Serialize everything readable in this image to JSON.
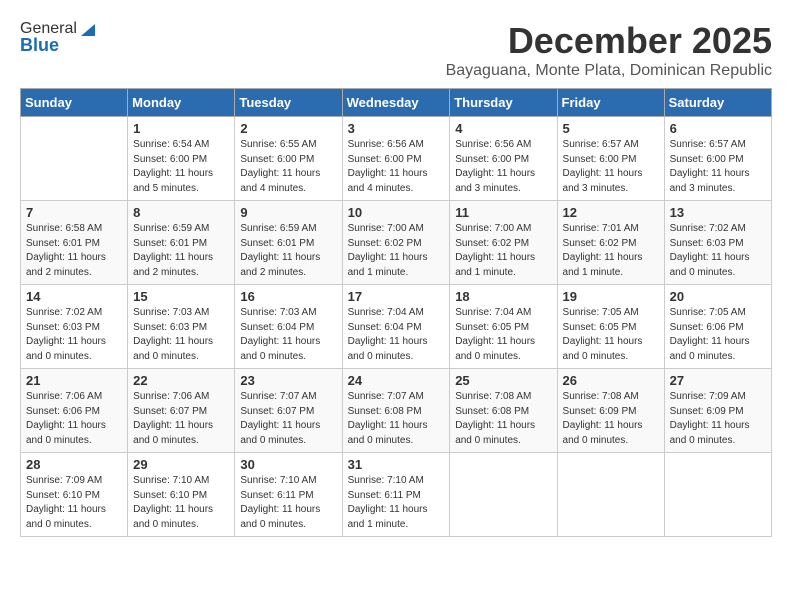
{
  "header": {
    "logo_general": "General",
    "logo_blue": "Blue",
    "month_title": "December 2025",
    "location": "Bayaguana, Monte Plata, Dominican Republic"
  },
  "days_of_week": [
    "Sunday",
    "Monday",
    "Tuesday",
    "Wednesday",
    "Thursday",
    "Friday",
    "Saturday"
  ],
  "weeks": [
    [
      {
        "day": "",
        "info": ""
      },
      {
        "day": "1",
        "info": "Sunrise: 6:54 AM\nSunset: 6:00 PM\nDaylight: 11 hours\nand 5 minutes."
      },
      {
        "day": "2",
        "info": "Sunrise: 6:55 AM\nSunset: 6:00 PM\nDaylight: 11 hours\nand 4 minutes."
      },
      {
        "day": "3",
        "info": "Sunrise: 6:56 AM\nSunset: 6:00 PM\nDaylight: 11 hours\nand 4 minutes."
      },
      {
        "day": "4",
        "info": "Sunrise: 6:56 AM\nSunset: 6:00 PM\nDaylight: 11 hours\nand 3 minutes."
      },
      {
        "day": "5",
        "info": "Sunrise: 6:57 AM\nSunset: 6:00 PM\nDaylight: 11 hours\nand 3 minutes."
      },
      {
        "day": "6",
        "info": "Sunrise: 6:57 AM\nSunset: 6:00 PM\nDaylight: 11 hours\nand 3 minutes."
      }
    ],
    [
      {
        "day": "7",
        "info": "Sunrise: 6:58 AM\nSunset: 6:01 PM\nDaylight: 11 hours\nand 2 minutes."
      },
      {
        "day": "8",
        "info": "Sunrise: 6:59 AM\nSunset: 6:01 PM\nDaylight: 11 hours\nand 2 minutes."
      },
      {
        "day": "9",
        "info": "Sunrise: 6:59 AM\nSunset: 6:01 PM\nDaylight: 11 hours\nand 2 minutes."
      },
      {
        "day": "10",
        "info": "Sunrise: 7:00 AM\nSunset: 6:02 PM\nDaylight: 11 hours\nand 1 minute."
      },
      {
        "day": "11",
        "info": "Sunrise: 7:00 AM\nSunset: 6:02 PM\nDaylight: 11 hours\nand 1 minute."
      },
      {
        "day": "12",
        "info": "Sunrise: 7:01 AM\nSunset: 6:02 PM\nDaylight: 11 hours\nand 1 minute."
      },
      {
        "day": "13",
        "info": "Sunrise: 7:02 AM\nSunset: 6:03 PM\nDaylight: 11 hours\nand 0 minutes."
      }
    ],
    [
      {
        "day": "14",
        "info": "Sunrise: 7:02 AM\nSunset: 6:03 PM\nDaylight: 11 hours\nand 0 minutes."
      },
      {
        "day": "15",
        "info": "Sunrise: 7:03 AM\nSunset: 6:03 PM\nDaylight: 11 hours\nand 0 minutes."
      },
      {
        "day": "16",
        "info": "Sunrise: 7:03 AM\nSunset: 6:04 PM\nDaylight: 11 hours\nand 0 minutes."
      },
      {
        "day": "17",
        "info": "Sunrise: 7:04 AM\nSunset: 6:04 PM\nDaylight: 11 hours\nand 0 minutes."
      },
      {
        "day": "18",
        "info": "Sunrise: 7:04 AM\nSunset: 6:05 PM\nDaylight: 11 hours\nand 0 minutes."
      },
      {
        "day": "19",
        "info": "Sunrise: 7:05 AM\nSunset: 6:05 PM\nDaylight: 11 hours\nand 0 minutes."
      },
      {
        "day": "20",
        "info": "Sunrise: 7:05 AM\nSunset: 6:06 PM\nDaylight: 11 hours\nand 0 minutes."
      }
    ],
    [
      {
        "day": "21",
        "info": "Sunrise: 7:06 AM\nSunset: 6:06 PM\nDaylight: 11 hours\nand 0 minutes."
      },
      {
        "day": "22",
        "info": "Sunrise: 7:06 AM\nSunset: 6:07 PM\nDaylight: 11 hours\nand 0 minutes."
      },
      {
        "day": "23",
        "info": "Sunrise: 7:07 AM\nSunset: 6:07 PM\nDaylight: 11 hours\nand 0 minutes."
      },
      {
        "day": "24",
        "info": "Sunrise: 7:07 AM\nSunset: 6:08 PM\nDaylight: 11 hours\nand 0 minutes."
      },
      {
        "day": "25",
        "info": "Sunrise: 7:08 AM\nSunset: 6:08 PM\nDaylight: 11 hours\nand 0 minutes."
      },
      {
        "day": "26",
        "info": "Sunrise: 7:08 AM\nSunset: 6:09 PM\nDaylight: 11 hours\nand 0 minutes."
      },
      {
        "day": "27",
        "info": "Sunrise: 7:09 AM\nSunset: 6:09 PM\nDaylight: 11 hours\nand 0 minutes."
      }
    ],
    [
      {
        "day": "28",
        "info": "Sunrise: 7:09 AM\nSunset: 6:10 PM\nDaylight: 11 hours\nand 0 minutes."
      },
      {
        "day": "29",
        "info": "Sunrise: 7:10 AM\nSunset: 6:10 PM\nDaylight: 11 hours\nand 0 minutes."
      },
      {
        "day": "30",
        "info": "Sunrise: 7:10 AM\nSunset: 6:11 PM\nDaylight: 11 hours\nand 0 minutes."
      },
      {
        "day": "31",
        "info": "Sunrise: 7:10 AM\nSunset: 6:11 PM\nDaylight: 11 hours\nand 1 minute."
      },
      {
        "day": "",
        "info": ""
      },
      {
        "day": "",
        "info": ""
      },
      {
        "day": "",
        "info": ""
      }
    ]
  ]
}
